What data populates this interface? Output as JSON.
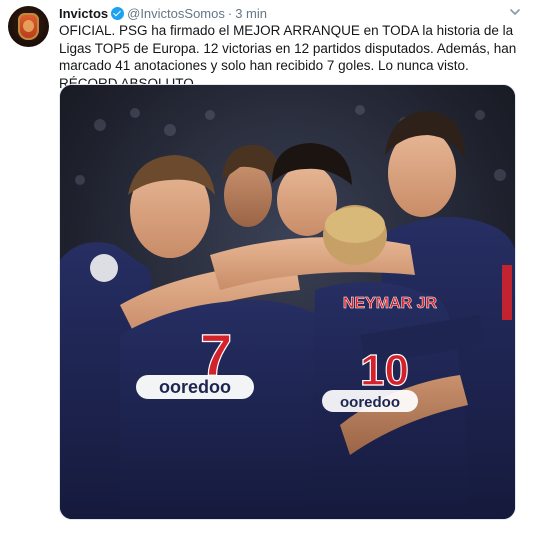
{
  "tweet": {
    "author_name": "Invictos",
    "handle": "@InvictosSomos",
    "separator": "·",
    "time": "3 min",
    "text": "OFICIAL. PSG ha firmado el MEJOR ARRANQUE en TODA la historia de la Ligas TOP5 de Europa. 12 victorias en 12 partidos disputados. Además, han marcado 41 anotaciones y solo han recibido 7 goles. Lo nunca visto. RÉCORD ABSOLUTO."
  },
  "photo": {
    "shirt_number_left": "7",
    "sponsor_left": "ooredoo",
    "shirt_name_right": "NEYMAR JR",
    "shirt_number_right": "10",
    "sponsor_right": "ooredoo"
  },
  "icons": {
    "avatar": "invictos-logo-avatar",
    "verified": "verified-badge-icon",
    "caret": "chevron-down-icon"
  },
  "colors": {
    "text": "#14171a",
    "muted": "#657786",
    "verified": "#1da1f2",
    "kit_navy": "#1e2550",
    "kit_red": "#d3222b"
  }
}
